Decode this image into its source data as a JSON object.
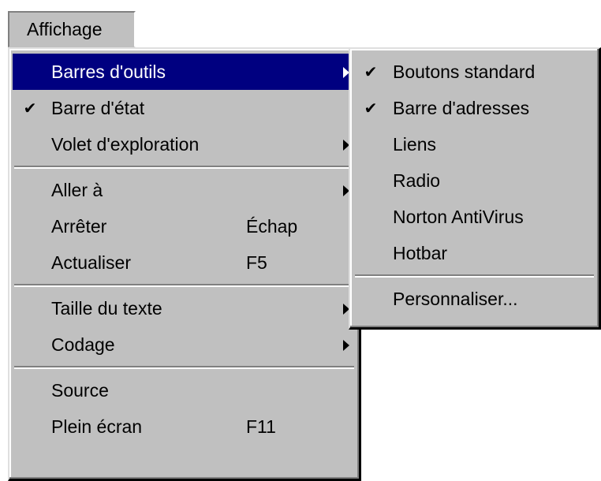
{
  "menubar": {
    "title": "Affichage"
  },
  "main_menu": {
    "items": [
      {
        "label": "Barres d'outils",
        "shortcut": "",
        "submenu": true,
        "checked": false
      },
      {
        "label": "Barre d'état",
        "shortcut": "",
        "submenu": false,
        "checked": true
      },
      {
        "label": "Volet d'exploration",
        "shortcut": "",
        "submenu": true,
        "checked": false
      },
      {
        "label": "Aller à",
        "shortcut": "",
        "submenu": true,
        "checked": false
      },
      {
        "label": "Arrêter",
        "shortcut": "Échap",
        "submenu": false,
        "checked": false
      },
      {
        "label": "Actualiser",
        "shortcut": "F5",
        "submenu": false,
        "checked": false
      },
      {
        "label": "Taille du texte",
        "shortcut": "",
        "submenu": true,
        "checked": false
      },
      {
        "label": "Codage",
        "shortcut": "",
        "submenu": true,
        "checked": false
      },
      {
        "label": "Source",
        "shortcut": "",
        "submenu": false,
        "checked": false
      },
      {
        "label": "Plein écran",
        "shortcut": "F11",
        "submenu": false,
        "checked": false
      }
    ]
  },
  "toolbars_submenu": {
    "items": [
      {
        "label": "Boutons standard",
        "checked": true
      },
      {
        "label": "Barre d'adresses",
        "checked": true
      },
      {
        "label": "Liens",
        "checked": false
      },
      {
        "label": "Radio",
        "checked": false
      },
      {
        "label": "Norton AntiVirus",
        "checked": false
      },
      {
        "label": "Hotbar",
        "checked": false
      },
      {
        "label": "Personnaliser...",
        "checked": false
      }
    ]
  },
  "icons": {
    "check": "✔",
    "check_icon_name": "checkmark-icon",
    "submenu_icon_name": "submenu-arrow-icon"
  },
  "colors": {
    "menu_background": "#c0c0c0",
    "highlight_background": "#000080",
    "highlight_text": "#ffffff",
    "text": "#000000"
  }
}
